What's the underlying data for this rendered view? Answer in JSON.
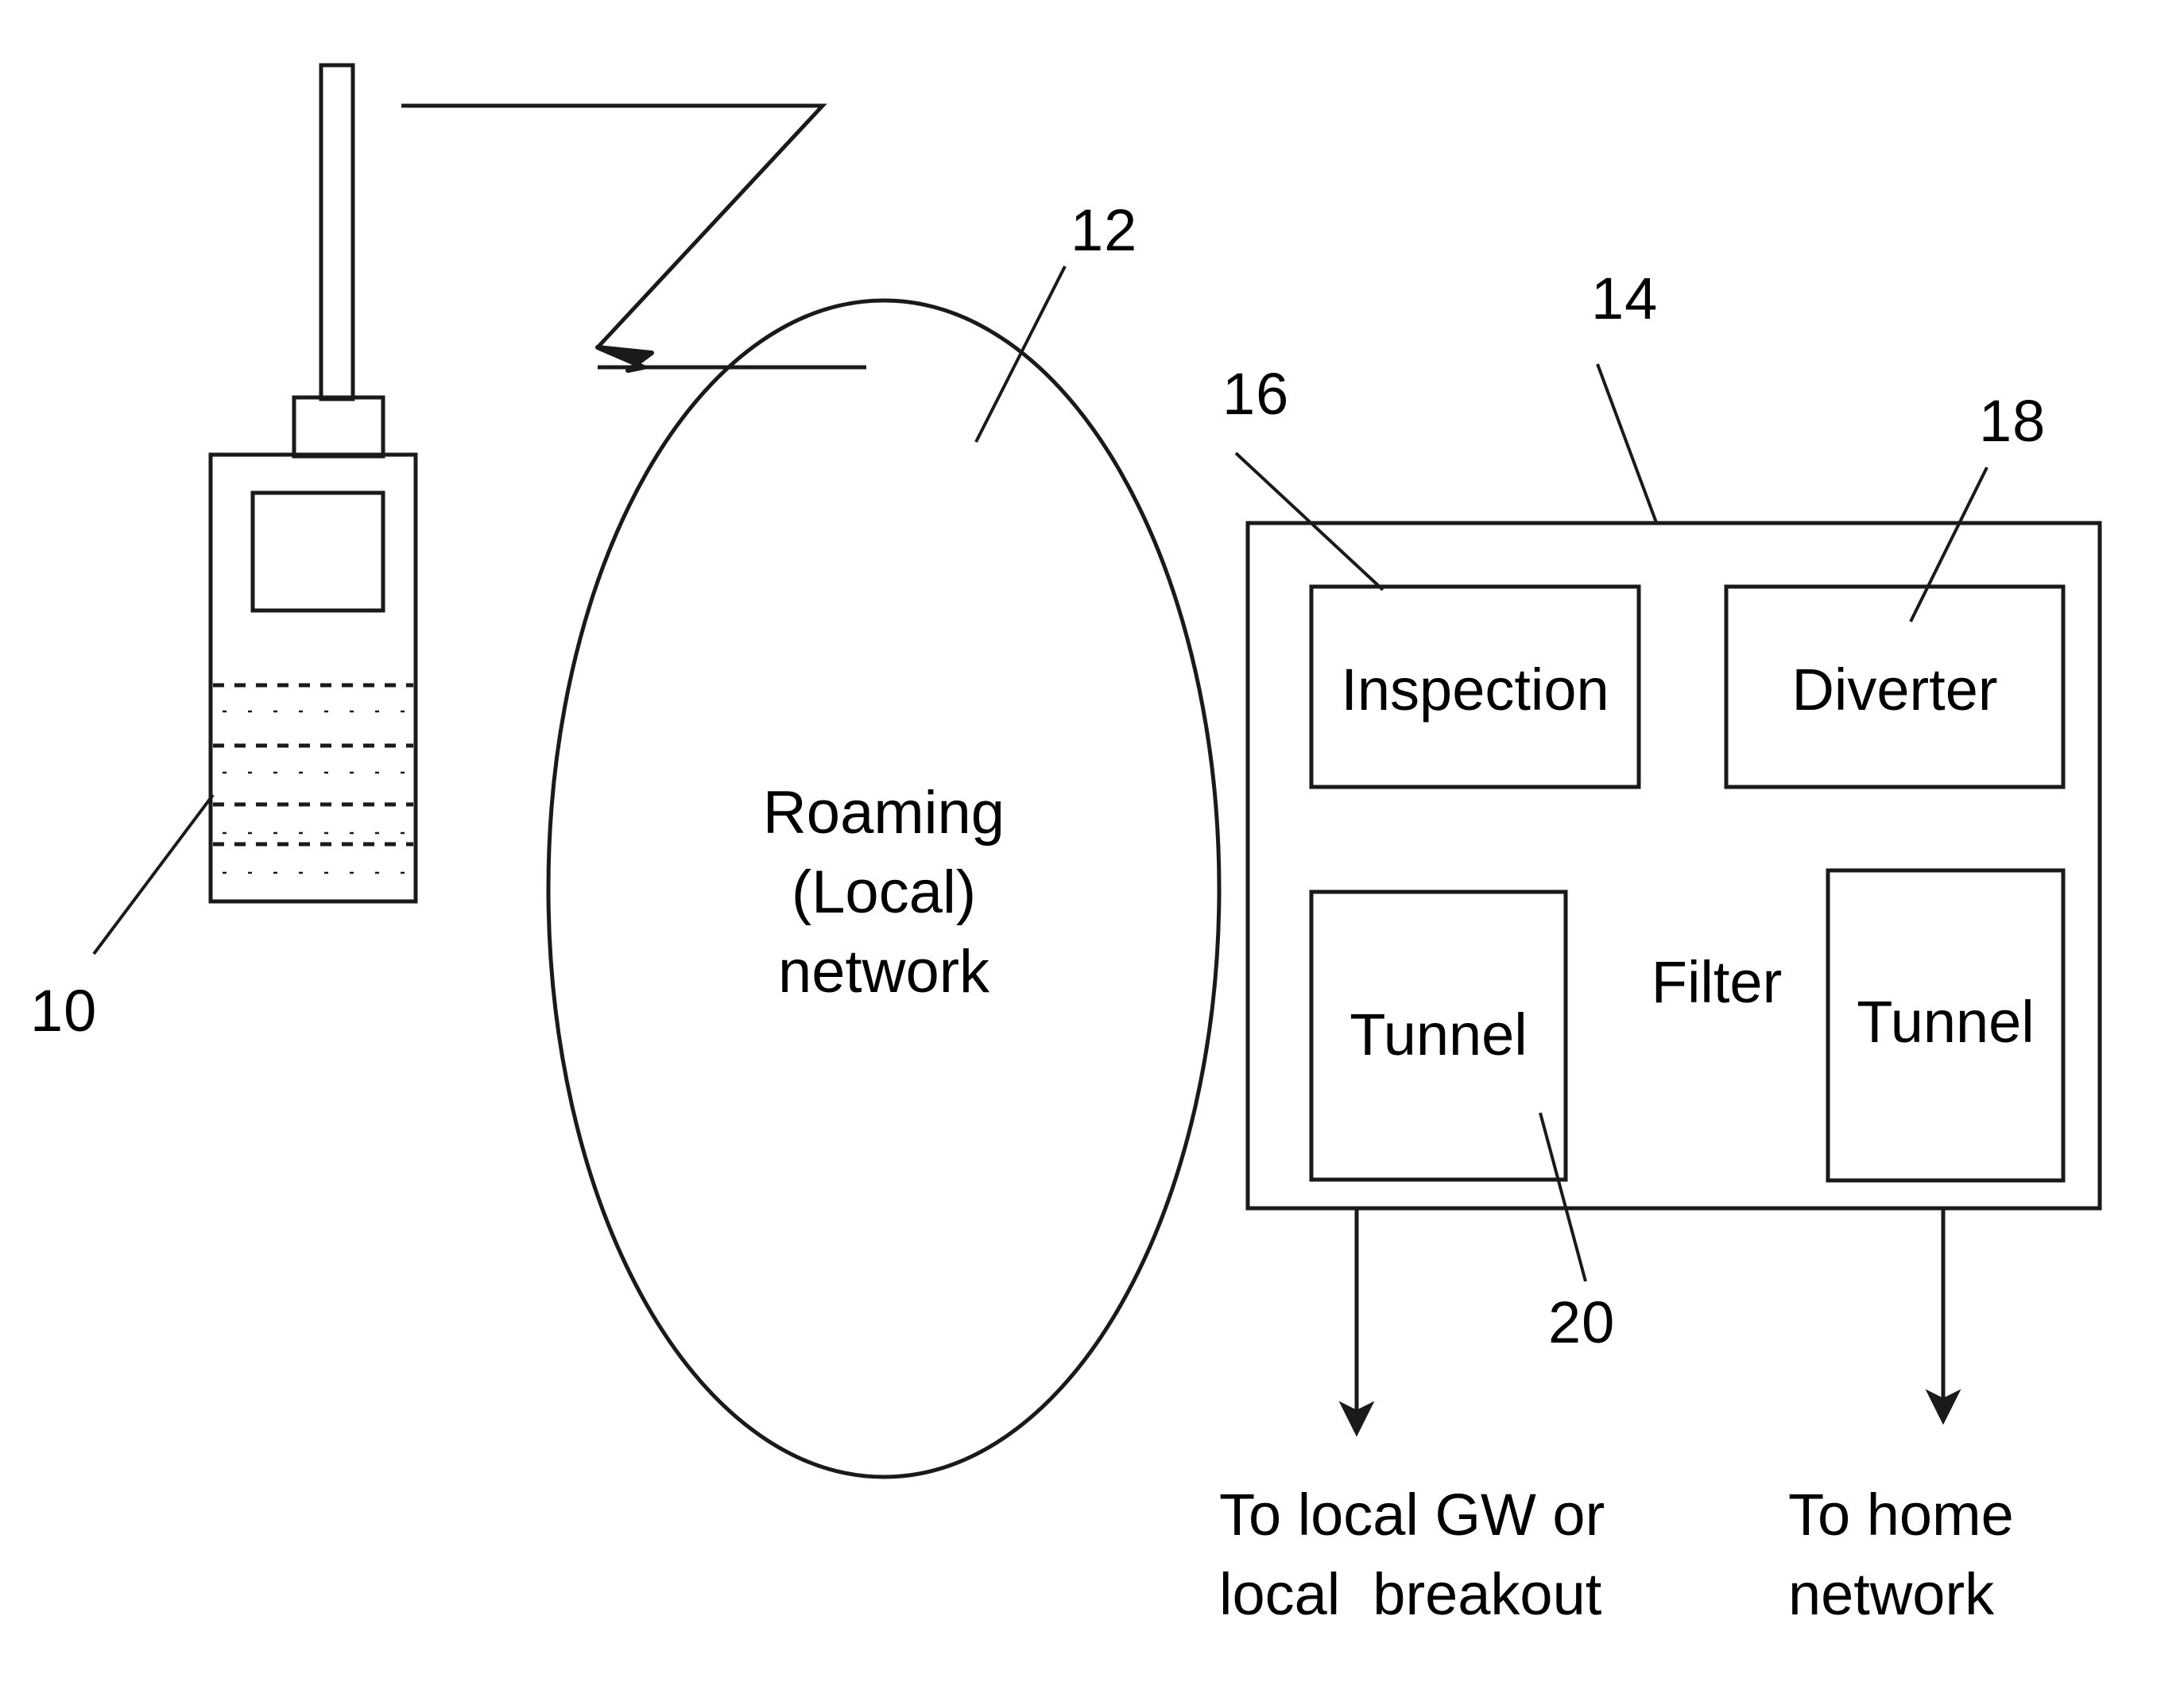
{
  "figure": {
    "type": "patent-network-diagram",
    "background_color": "#ffffff",
    "line_color": "#1a1a1a"
  },
  "mobile_device": {
    "name": "mobile handset",
    "reference_numeral": "10",
    "parts": {
      "antenna": "antenna",
      "earpiece": "earpiece",
      "screen": "display screen",
      "keypad": "keypad"
    }
  },
  "radio_link": {
    "name": "radio link zigzag arrow",
    "direction": "from handset antenna to roaming network"
  },
  "cloud": {
    "reference_numeral": "12",
    "line1": "Roaming",
    "line2": "(Local)",
    "line3": "network"
  },
  "gateway_box": {
    "reference_numeral": "14",
    "filter_label": "Filter",
    "blocks": [
      {
        "label": "Inspection",
        "reference_numeral": "16"
      },
      {
        "label": "Diverter",
        "reference_numeral": "18"
      },
      {
        "label": "Tunnel",
        "reference_numeral": "20"
      },
      {
        "label": "Tunnel",
        "reference_numeral": ""
      }
    ]
  },
  "outputs": {
    "left": {
      "line1": "To local GW or",
      "line2": "local  breakout"
    },
    "right": {
      "line1": "To home",
      "line2": "network"
    }
  },
  "reference_numerals": {
    "handset": "10",
    "network": "12",
    "gateway": "14",
    "inspection": "16",
    "diverter": "18",
    "tunnel_left": "20"
  }
}
